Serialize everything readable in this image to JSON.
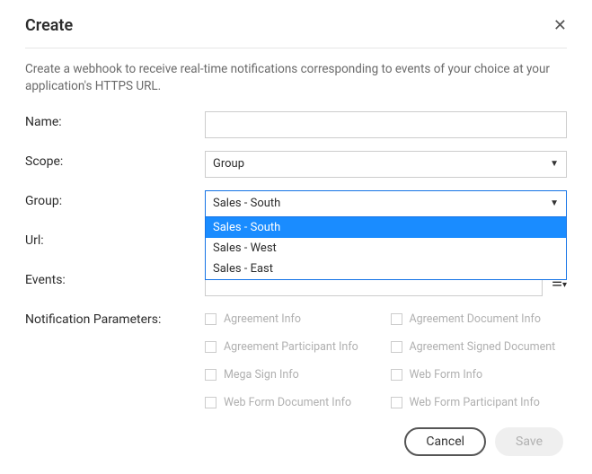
{
  "header": {
    "title": "Create"
  },
  "description": "Create a webhook to receive real-time notifications corresponding to events of your choice at your application's HTTPS URL.",
  "labels": {
    "name": "Name:",
    "scope": "Scope:",
    "group": "Group:",
    "url": "Url:",
    "events": "Events:",
    "params": "Notification Parameters:"
  },
  "scope": {
    "value": "Group"
  },
  "group": {
    "value": "Sales - South",
    "options": [
      "Sales - South",
      "Sales - West",
      "Sales - East"
    ]
  },
  "params": [
    "Agreement Info",
    "Agreement Document Info",
    "Agreement Participant Info",
    "Agreement Signed Document",
    "Mega Sign Info",
    "Web Form Info",
    "Web Form Document Info",
    "Web Form Participant Info"
  ],
  "footer": {
    "cancel": "Cancel",
    "save": "Save"
  }
}
